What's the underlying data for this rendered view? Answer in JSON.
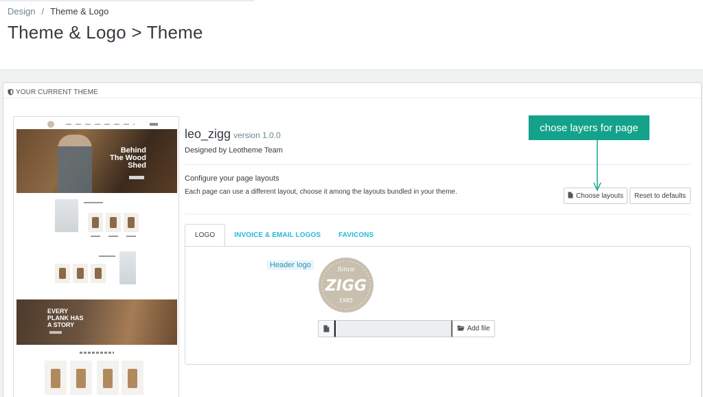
{
  "breadcrumb": {
    "parent": "Design",
    "separator": "/",
    "current": "Theme & Logo"
  },
  "page_title": "Theme & Logo > Theme",
  "panel": {
    "heading": "YOUR CURRENT THEME"
  },
  "preview": {
    "hero_text": "Behind\nThe Wood\nShed",
    "banner_text": "EVERY\nPLANK HAS\nA STORY"
  },
  "theme": {
    "name": "leo_zigg",
    "version": "version 1.0.0",
    "author": "Designed by Leotheme Team"
  },
  "layouts": {
    "title": "Configure your page layouts",
    "description": "Each page can use a different layout, choose it among the layouts bundled in your theme.",
    "choose_label": "Choose layouts",
    "reset_label": "Reset to defaults"
  },
  "annotation": {
    "text": "chose layers for page"
  },
  "tabs": [
    {
      "label": "LOGO",
      "active": true
    },
    {
      "label": "INVOICE & EMAIL LOGOS",
      "active": false
    },
    {
      "label": "FAVICONS",
      "active": false
    }
  ],
  "logo_tab": {
    "field_label": "Header logo",
    "logo_lines": {
      "top": "Since",
      "main": "ZIGG",
      "bottom": "1985"
    },
    "file_value": "",
    "add_file_label": "Add file"
  },
  "colors": {
    "accent": "#25b9d7",
    "annotation": "#14a28a",
    "logo_bg": "#c9bfae"
  }
}
